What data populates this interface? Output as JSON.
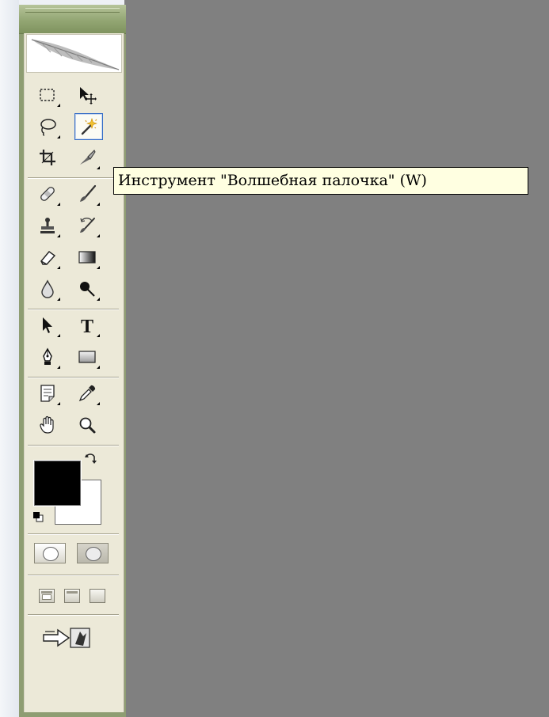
{
  "tooltip": {
    "text": "Инструмент \"Волшебная палочка\" (W)"
  },
  "colors": {
    "canvas": "#808080",
    "panel": "#ece9d8",
    "titlebar": "#93a673",
    "foreground": "#000000",
    "background": "#ffffff",
    "active_border": "#316ac5",
    "tooltip_bg": "#ffffe1"
  },
  "tools": [
    {
      "id": "marquee",
      "icon": "rect-marquee-icon"
    },
    {
      "id": "move",
      "icon": "move-icon"
    },
    {
      "id": "lasso",
      "icon": "lasso-icon"
    },
    {
      "id": "magic-wand",
      "icon": "magic-wand-icon",
      "active": true
    },
    {
      "id": "crop",
      "icon": "crop-icon"
    },
    {
      "id": "slice",
      "icon": "slice-knife-icon"
    },
    {
      "id": "healing",
      "icon": "healing-bandage-icon"
    },
    {
      "id": "brush",
      "icon": "brush-icon"
    },
    {
      "id": "stamp",
      "icon": "clone-stamp-icon"
    },
    {
      "id": "history-brush",
      "icon": "history-brush-icon"
    },
    {
      "id": "eraser",
      "icon": "eraser-icon"
    },
    {
      "id": "gradient",
      "icon": "gradient-icon"
    },
    {
      "id": "blur",
      "icon": "blur-drop-icon"
    },
    {
      "id": "dodge",
      "icon": "dodge-icon"
    },
    {
      "id": "path-select",
      "icon": "path-selection-arrow-icon"
    },
    {
      "id": "type",
      "icon": "type-icon",
      "glyph": "T"
    },
    {
      "id": "pen",
      "icon": "pen-icon"
    },
    {
      "id": "shape",
      "icon": "rectangle-shape-icon"
    },
    {
      "id": "notes",
      "icon": "notes-icon"
    },
    {
      "id": "eyedropper",
      "icon": "eyedropper-icon"
    },
    {
      "id": "hand",
      "icon": "hand-icon"
    },
    {
      "id": "zoom",
      "icon": "zoom-magnifier-icon"
    }
  ]
}
